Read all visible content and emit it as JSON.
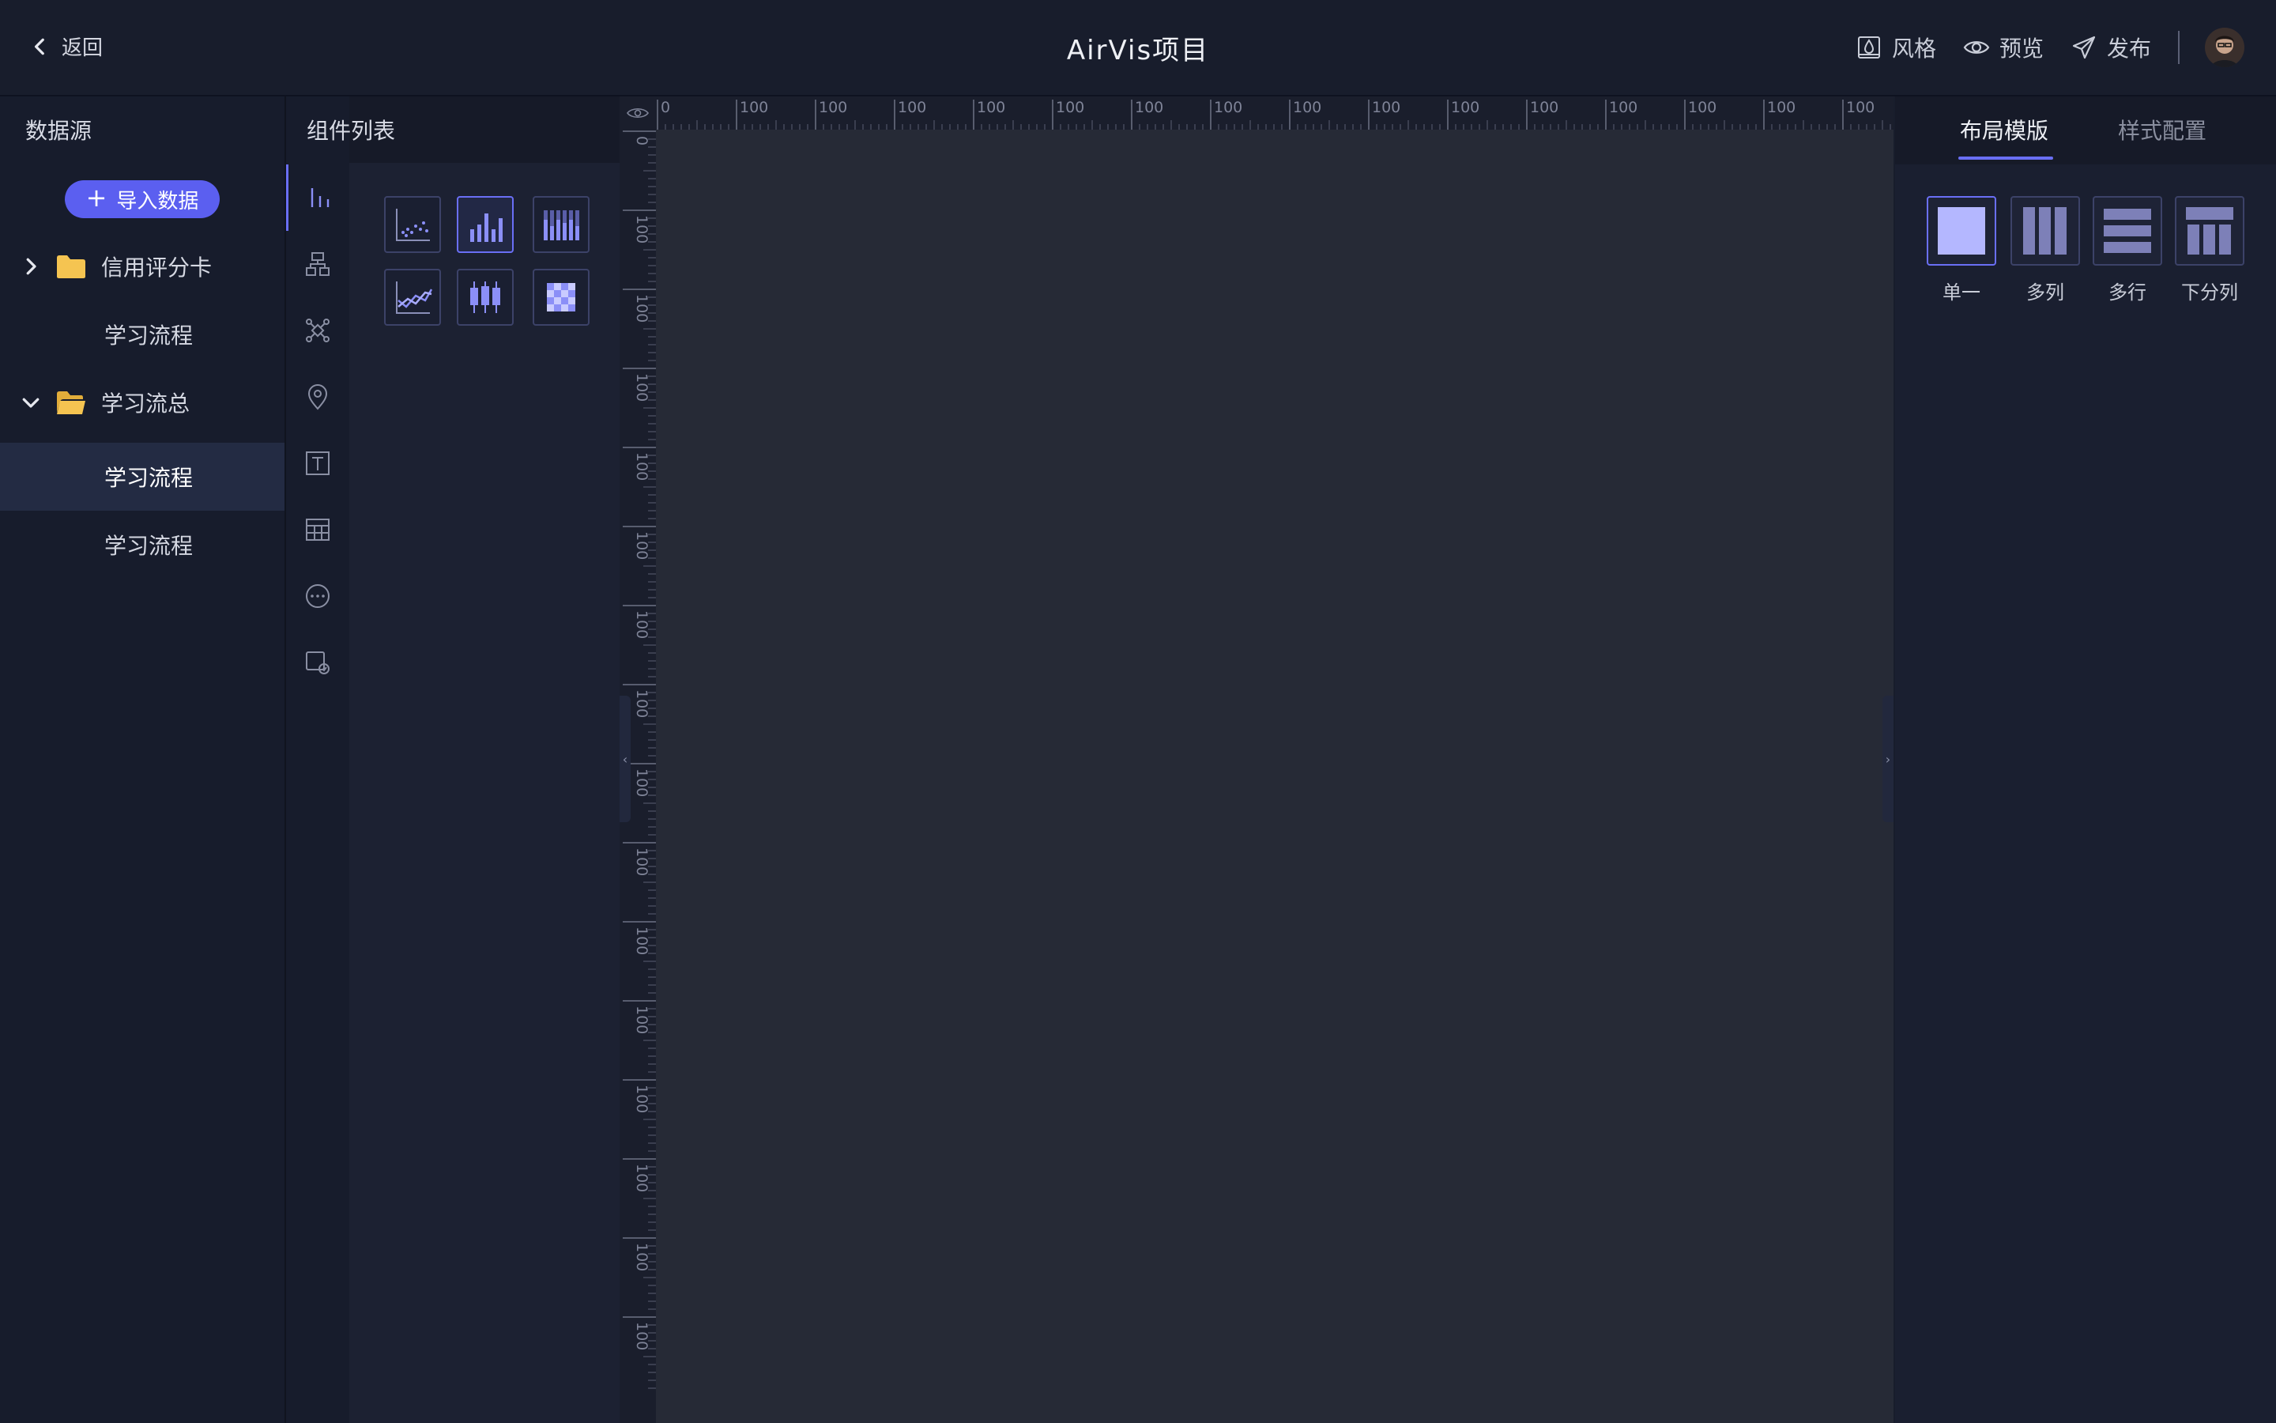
{
  "header": {
    "back_label": "返回",
    "title": "AirVis项目",
    "actions": [
      {
        "label": "风格",
        "icon": "style-icon"
      },
      {
        "label": "预览",
        "icon": "eye-icon"
      },
      {
        "label": "发布",
        "icon": "send-icon"
      }
    ]
  },
  "datasource": {
    "title": "数据源",
    "import_label": "导入数据",
    "items": [
      {
        "label": "信用评分卡",
        "type": "folder",
        "expanded": false
      },
      {
        "label": "学习流程",
        "type": "table"
      },
      {
        "label": "学习流总",
        "type": "folder",
        "expanded": true
      },
      {
        "label": "学习流程",
        "type": "table",
        "active": true
      },
      {
        "label": "学习流程",
        "type": "table"
      }
    ]
  },
  "components": {
    "title": "组件列表",
    "categories": [
      "bar-chart-icon",
      "hierarchy-icon",
      "network-icon",
      "map-pin-icon",
      "text-icon",
      "table-icon",
      "more-icon",
      "media-icon"
    ],
    "tiles": [
      "scatter-chart-icon",
      "bar-chart-icon",
      "stacked-bar-chart-icon",
      "line-chart-icon",
      "box-plot-icon",
      "heatmap-icon"
    ]
  },
  "rulers": {
    "h_labels": [
      "0",
      "100",
      "100",
      "100",
      "100",
      "100",
      "100",
      "100",
      "100",
      "100",
      "100",
      "100",
      "100",
      "100",
      "100",
      "100"
    ],
    "v_labels": [
      "0",
      "100",
      "100",
      "100",
      "100",
      "100",
      "100",
      "100",
      "100",
      "100",
      "100",
      "100",
      "100",
      "100",
      "100",
      "100"
    ]
  },
  "config": {
    "tabs": [
      "布局模版",
      "样式配置"
    ],
    "layouts": [
      {
        "label": "单一",
        "icon": "layout-single-icon"
      },
      {
        "label": "多列",
        "icon": "layout-columns-icon"
      },
      {
        "label": "多行",
        "icon": "layout-rows-icon"
      },
      {
        "label": "下分列",
        "icon": "layout-split-icon"
      }
    ]
  },
  "colors": {
    "accent": "#5b5ff0",
    "folder": "#f5c451",
    "canvas": "#262a36"
  }
}
